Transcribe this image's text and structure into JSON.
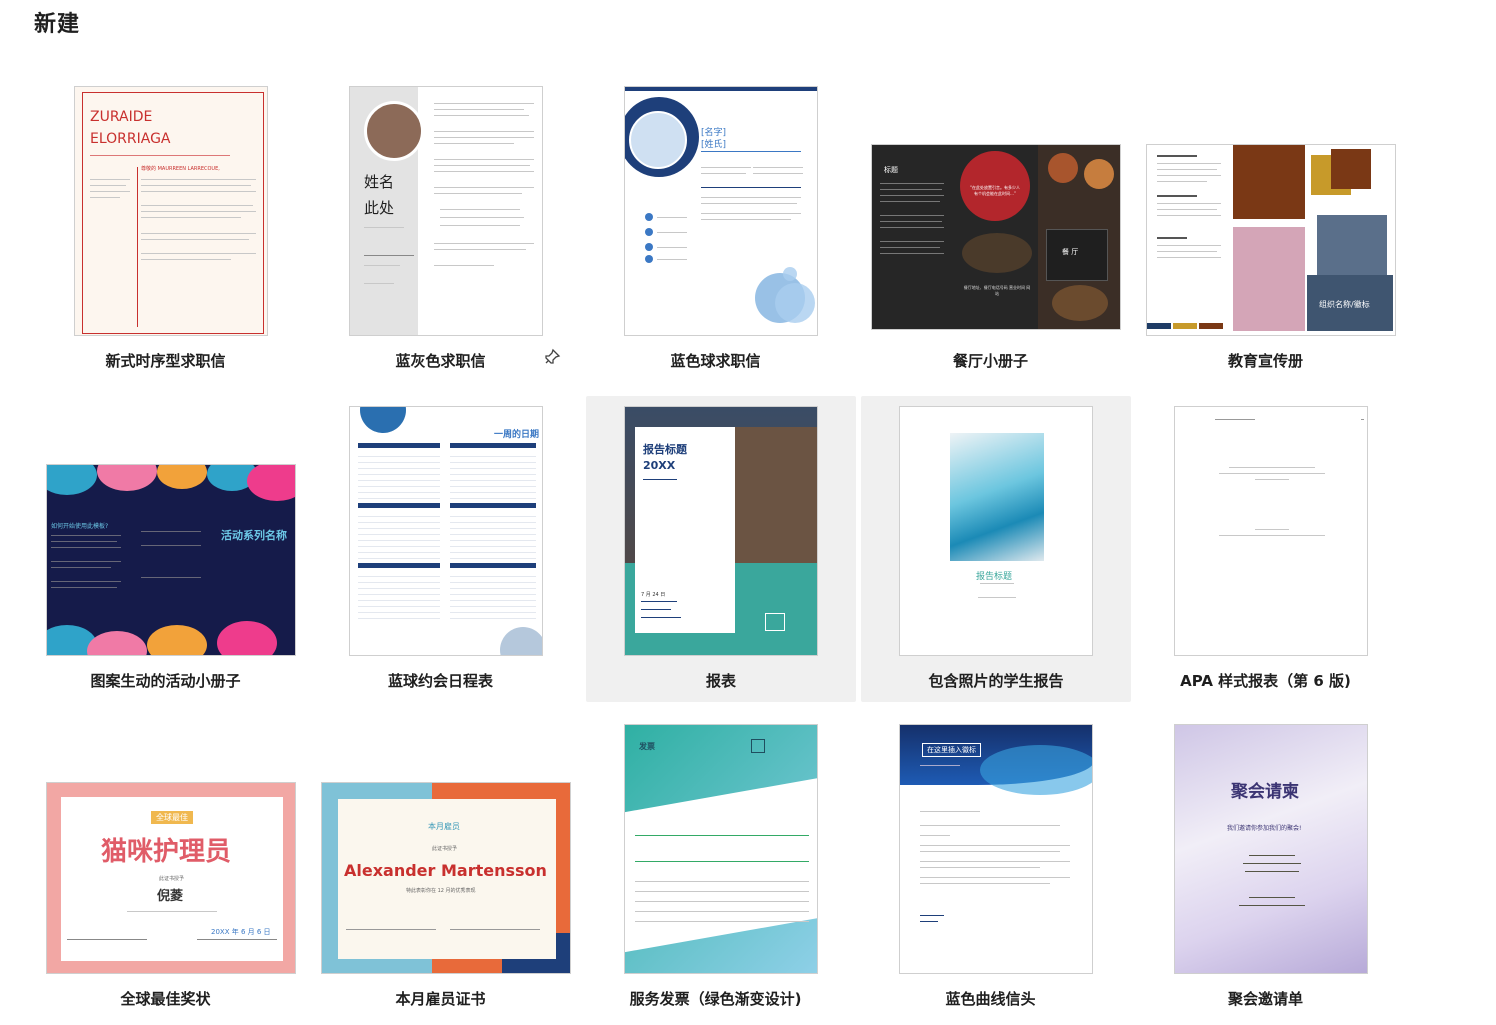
{
  "page_title": "新建",
  "templates": [
    {
      "label": "新式时序型求职信",
      "name_line1": "ZURAIDE",
      "name_line2": "ELORRIAGA",
      "salutation": "尊敬的 MAURREEN LARRECOUE,"
    },
    {
      "label": "蓝灰色求职信",
      "name_line1": "姓名",
      "name_line2": "此处",
      "pinned": true
    },
    {
      "label": "蓝色球求职信",
      "name_line1": "[名字]",
      "name_line2": "[姓氏]"
    },
    {
      "label": "餐厅小册子",
      "panel_title": "标题",
      "quote": "“在此处放置引言。有多少人有个机会能在此时间…”",
      "sign": "餐 厅",
      "footer": "餐厅地址、餐厅电话号码 营业时间 网站"
    },
    {
      "label": "教育宣传册",
      "org_label": "组织名称/徽标"
    },
    {
      "label": "图案生动的活动小册子",
      "event_name": "活动系列名称",
      "q": "如何开始使用此模板?"
    },
    {
      "label": "蓝球约会日程表",
      "week_title": "一周的日期"
    },
    {
      "label": "报表",
      "report_title": "报告标题",
      "year": "20XX",
      "date": "7 月 24 日"
    },
    {
      "label": "包含照片的学生报告",
      "report_title": "报告标题"
    },
    {
      "label": "APA 样式报表（第 6 版)"
    },
    {
      "label": "全球最佳奖状",
      "badge": "全球最佳",
      "title": "猫咪护理员",
      "presented": "此证书授予",
      "name": "倪菱",
      "date": "20XX 年 6 月 6 日"
    },
    {
      "label": "本月雇员证书",
      "badge": "本月雇员",
      "presented": "此证书授予",
      "name": "Alexander Martensson",
      "sub": "特此表彰你在 12 月的优秀表现"
    },
    {
      "label": "服务发票（绿色渐变设计)",
      "heading": "发票"
    },
    {
      "label": "蓝色曲线信头",
      "banner": "在这里插入徽标"
    },
    {
      "label": "聚会邀请单",
      "title": "聚会请柬",
      "sub": "我们邀请你参加我们的聚会!"
    }
  ],
  "colors": {
    "accent_red": "#c8302e",
    "navy": "#1b2f66",
    "teal": "#3aa79c",
    "hover_bg": "#f0f0f0"
  }
}
